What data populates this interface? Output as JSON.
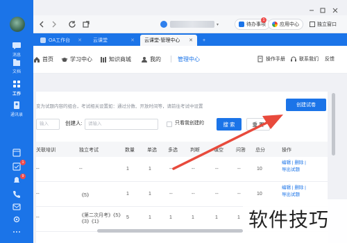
{
  "rail": {
    "items": [
      {
        "label": "消息",
        "icon": "chat-icon"
      },
      {
        "label": "文档",
        "icon": "document-icon"
      },
      {
        "label": "工作",
        "icon": "grid-icon"
      },
      {
        "label": "通讯录",
        "icon": "contacts-icon"
      }
    ],
    "badges": {
      "tasks": "1",
      "bell": "9"
    }
  },
  "titlebar": {
    "pending_label": "待办事项",
    "pending_badge": "1",
    "apps_label": "应用中心",
    "window_label": "独立窗口"
  },
  "tabs": [
    {
      "label": "OA工作台"
    },
    {
      "label": "云课堂"
    },
    {
      "label": "云课堂-管理中心",
      "active": true
    }
  ],
  "appnav": {
    "items": [
      "首页",
      "学习中心",
      "知识商城",
      "我的",
      "管理中心"
    ],
    "active": "管理中心",
    "right": [
      "操作手册",
      "联系我们",
      "反馈"
    ]
  },
  "content": {
    "hint": "变为试题内容的组合，考试相关设置如：通过分数、开放时间等，请前往考试中设置",
    "create_button": "创建试卷",
    "filters": {
      "first_placeholder": "输入",
      "creator_label": "创建人:",
      "creator_placeholder": "请输入",
      "only_mine_label": "只看我创建的",
      "search_label": "搜 索",
      "reset_label": "重 置"
    },
    "table": {
      "headers": [
        "关联培训",
        "独立考试",
        "数量",
        "单选",
        "多选",
        "判断",
        "填空",
        "问答",
        "总分",
        "操作"
      ],
      "rows": [
        {
          "training": "--",
          "exam": "--",
          "count": "1",
          "single": "1",
          "multi": "--",
          "judge": "--",
          "fill": "--",
          "qa": "--",
          "total": "10",
          "ops": [
            "编辑",
            "删除",
            "导出试题"
          ]
        },
        {
          "training": "--",
          "exam": "《5》",
          "count": "1",
          "single": "1",
          "multi": "--",
          "judge": "--",
          "fill": "--",
          "qa": "--",
          "total": "10",
          "ops": [
            "编辑",
            "删除",
            "导出试题"
          ]
        },
        {
          "training": "--",
          "exam": "《第二次月考》《5》《3》《1》",
          "count": "5",
          "single": "1",
          "multi": "1",
          "judge": "1",
          "fill": "1",
          "qa": "1",
          "total": "50",
          "ops": [
            "编辑",
            "删除"
          ]
        }
      ]
    }
  },
  "watermark": "软件技巧",
  "colors": {
    "accent": "#1b74e8",
    "annotation": "#e84a3c"
  }
}
